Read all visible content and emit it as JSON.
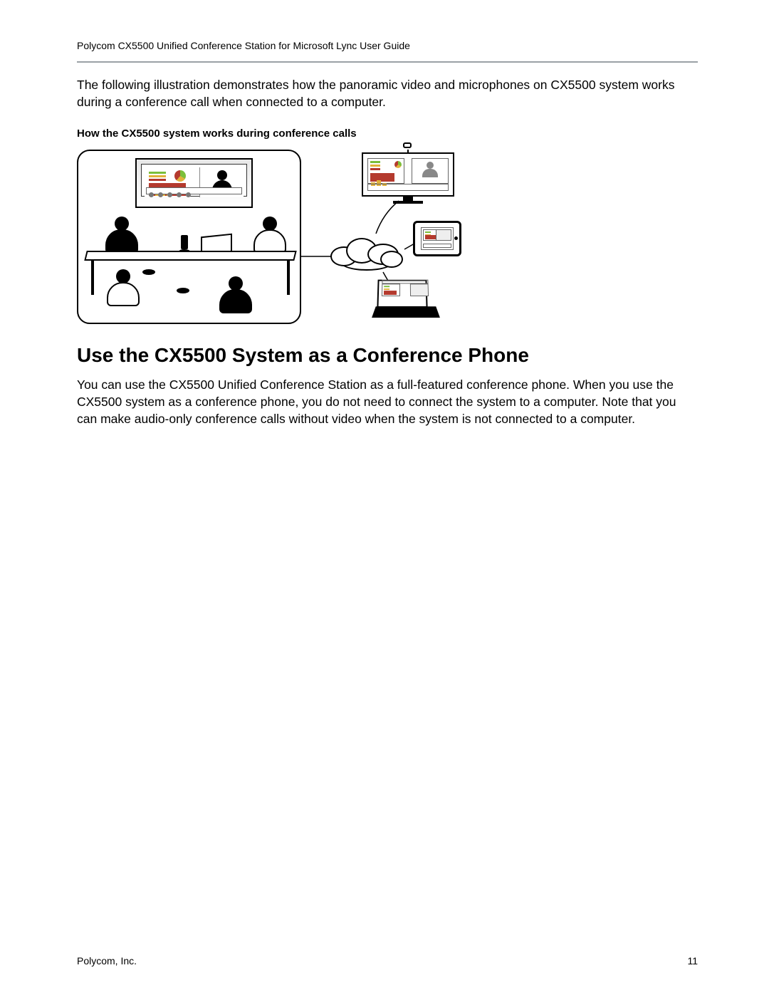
{
  "header": {
    "running_title": "Polycom CX5500 Unified Conference Station for Microsoft Lync User Guide"
  },
  "intro": "The following illustration demonstrates how the panoramic video and microphones on CX5500 system works during a conference call when connected to a computer.",
  "figure": {
    "caption": "How the CX5500 system works during conference calls",
    "alt": "Diagram of a conference room with four participants around a table using a CX5500 device connected to a laptop and wall display; the system connects through a cloud to a remote desktop monitor with webcam, a tablet, and a laptop, each showing the shared presentation, active-speaker video, and panoramic strip."
  },
  "section": {
    "heading": "Use the CX5500 System as a Conference Phone",
    "body": "You can use the CX5500 Unified Conference Station as a full-featured conference phone. When you use the CX5500 system as a conference phone, you do not need to connect the system to a computer. Note that you can make audio-only conference calls without video when the system is not connected to a computer."
  },
  "footer": {
    "company": "Polycom, Inc.",
    "page_number": "11"
  }
}
